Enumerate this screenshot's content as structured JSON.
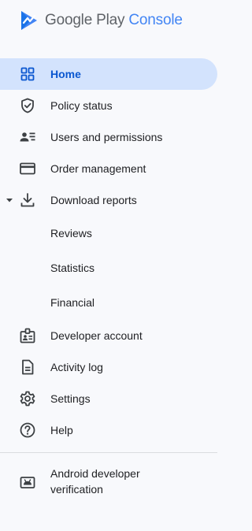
{
  "brand": {
    "google_play": "Google Play",
    "console": "Console",
    "logo_icon": "play-console-logo-icon"
  },
  "nav": {
    "items": [
      {
        "label": "Home",
        "icon": "home-grid-icon",
        "active": true
      },
      {
        "label": "Policy status",
        "icon": "shield-check-icon"
      },
      {
        "label": "Users and permissions",
        "icon": "users-permissions-icon"
      },
      {
        "label": "Order management",
        "icon": "credit-card-icon"
      },
      {
        "label": "Download reports",
        "icon": "download-icon",
        "expanded": true
      },
      {
        "label": "Reviews"
      },
      {
        "label": "Statistics"
      },
      {
        "label": "Financial"
      },
      {
        "label": "Developer account",
        "icon": "developer-badge-icon"
      },
      {
        "label": "Activity log",
        "icon": "document-icon"
      },
      {
        "label": "Settings",
        "icon": "gear-icon"
      },
      {
        "label": "Help",
        "icon": "help-circle-icon"
      }
    ],
    "bottom": {
      "label": "Android developer verification",
      "icon": "android-icon"
    }
  },
  "colors": {
    "active_bg": "#d3e3fd",
    "active_text": "#0b57d0",
    "brand_blue": "#4285f4",
    "background": "#f8f9fc"
  }
}
